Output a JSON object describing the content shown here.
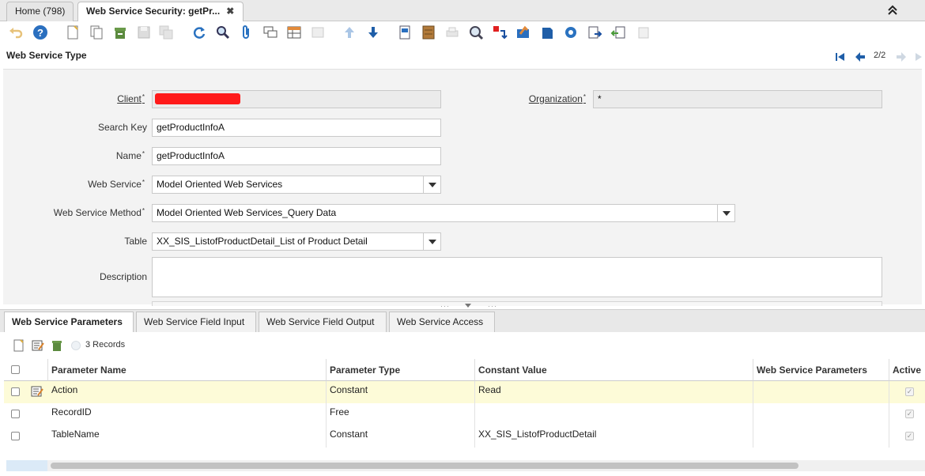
{
  "window_tabs": [
    {
      "label": "Home (798)",
      "active": false
    },
    {
      "label": "Web Service Security: getPr...",
      "active": true
    }
  ],
  "toolbar_icons": [
    "undo-icon",
    "help-icon",
    "new-record-icon",
    "copy-record-icon",
    "delete-record-icon",
    "save-icon",
    "save-new-icon",
    "refresh-icon",
    "find-icon",
    "attachment-icon",
    "chat-icon",
    "grid-toggle-icon",
    "history-icon",
    "previous-record-icon",
    "next-record-icon",
    "report-icon",
    "archive-icon",
    "print-icon",
    "zoom-across-icon",
    "requests-icon",
    "product-info-icon",
    "archived-docs-icon",
    "process-gear-icon",
    "export-icon",
    "import-icon",
    "customize-icon"
  ],
  "header": {
    "title": "Web Service Type",
    "record_nav": "2/2"
  },
  "form": {
    "client": {
      "label": "Client",
      "value": ""
    },
    "organization": {
      "label": "Organization",
      "value": "*"
    },
    "search_key": {
      "label": "Search Key",
      "value": "getProductInfoA"
    },
    "name": {
      "label": "Name",
      "value": "getProductInfoA"
    },
    "web_service": {
      "label": "Web Service",
      "value": "Model Oriented Web Services"
    },
    "web_service_method": {
      "label": "Web Service Method",
      "value": "Model Oriented Web Services_Query Data"
    },
    "table": {
      "label": "Table",
      "value": "XX_SIS_ListofProductDetail_List of Product Detail"
    },
    "description": {
      "label": "Description",
      "value": ""
    }
  },
  "detail_tabs": [
    {
      "label": "Web Service Parameters",
      "active": true
    },
    {
      "label": "Web Service Field Input",
      "active": false
    },
    {
      "label": "Web Service Field Output",
      "active": false
    },
    {
      "label": "Web Service Access",
      "active": false
    }
  ],
  "grid": {
    "record_count": "3 Records",
    "columns": [
      "Parameter Name",
      "Parameter Type",
      "Constant Value",
      "Web Service Parameters",
      "Active"
    ],
    "rows": [
      {
        "parameter_name": "Action",
        "parameter_type": "Constant",
        "constant_value": "Read",
        "ws_params": "",
        "active": true,
        "selected": true
      },
      {
        "parameter_name": "RecordID",
        "parameter_type": "Free",
        "constant_value": "",
        "ws_params": "",
        "active": true,
        "selected": false
      },
      {
        "parameter_name": "TableName",
        "parameter_type": "Constant",
        "constant_value": "XX_SIS_ListofProductDetail",
        "ws_params": "",
        "active": true,
        "selected": false
      }
    ]
  },
  "colors": {
    "selected_row": "#fdfbd8",
    "accent_blue": "#1a5fa8",
    "redaction": "#ff0000"
  }
}
